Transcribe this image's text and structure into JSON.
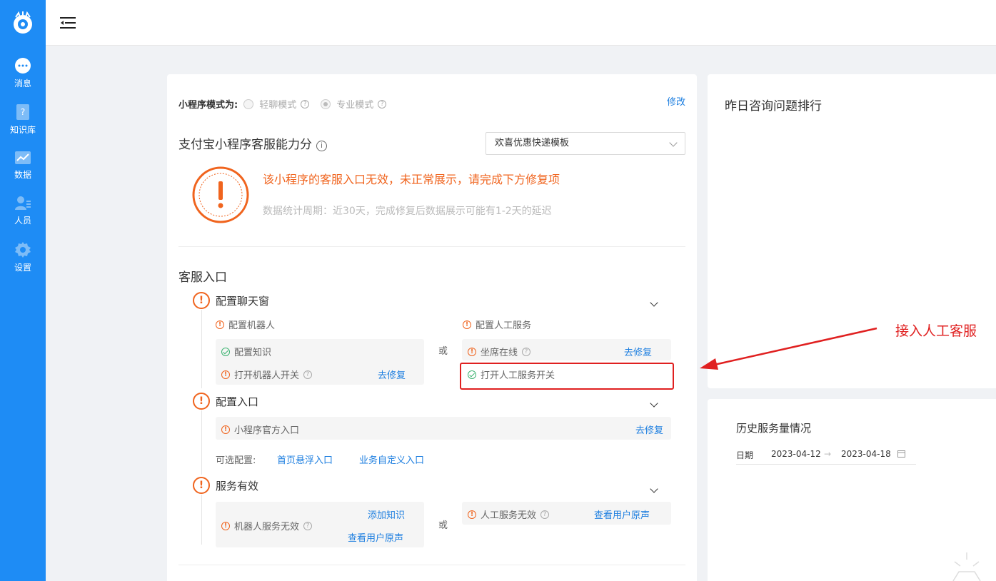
{
  "sidebar": {
    "items": [
      {
        "label": "消息",
        "icon": "chat-bubble-icon"
      },
      {
        "label": "知识库",
        "icon": "knowledge-book-icon"
      },
      {
        "label": "数据",
        "icon": "chart-icon"
      },
      {
        "label": "人员",
        "icon": "person-list-icon"
      },
      {
        "label": "设置",
        "icon": "gear-icon"
      }
    ]
  },
  "mode": {
    "label": "小程序模式为:",
    "options": [
      "轻聊模式",
      "专业模式"
    ],
    "selected": "专业模式",
    "edit": "修改"
  },
  "ability": {
    "title": "支付宝小程序客服能力分",
    "template": "欢喜优惠快递模板"
  },
  "warning": {
    "title": "该小程序的客服入口无效，未正常展示，请完成下方修复项",
    "subtitle": "数据统计周期：近30天，完成修复后数据展示可能有1-2天的延迟"
  },
  "entry": {
    "title": "客服入口",
    "steps": {
      "chat": {
        "title": "配置聊天窗",
        "robot": {
          "title": "配置机器人",
          "knowledge": "配置知识",
          "switch": "打开机器人开关",
          "fix": "去修复"
        },
        "or": "或",
        "human": {
          "title": "配置人工服务",
          "online": "坐席在线",
          "fix": "去修复",
          "switch": "打开人工服务开关"
        }
      },
      "entry": {
        "title": "配置入口",
        "official": "小程序官方入口",
        "fix": "去修复",
        "optional_label": "可选配置:",
        "opt1": "首页悬浮入口",
        "opt2": "业务自定义入口"
      },
      "valid": {
        "title": "服务有效",
        "robot_invalid": "机器人服务无效",
        "add_knowledge": "添加知识",
        "view_voice1": "查看用户原声",
        "or": "或",
        "human_invalid": "人工服务无效",
        "view_voice2": "查看用户原声"
      }
    }
  },
  "rank": {
    "title": "昨日咨询问题排行"
  },
  "history": {
    "title": "历史服务量情况",
    "date_label": "日期",
    "start": "2023-04-12",
    "sep": "→",
    "end": "2023-04-18"
  },
  "annotation": "接入人工客服",
  "colors": {
    "sidebar": "#1e8cf5",
    "warning": "#f0641e",
    "link": "#1e7fe0",
    "highlight": "#e02020"
  }
}
